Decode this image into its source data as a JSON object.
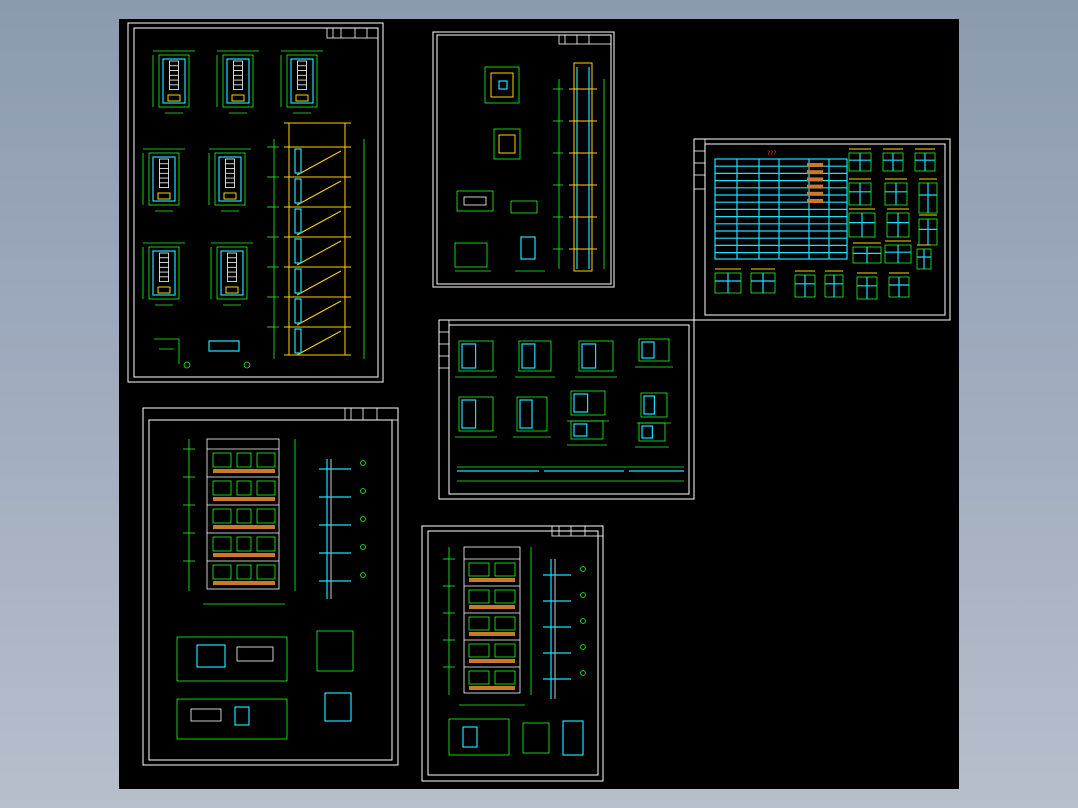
{
  "app": {
    "canvas_background": "#000000",
    "window_background": "#9aa6b8"
  },
  "colors": {
    "line_green": "#1cff1c",
    "line_cyan": "#19e0ff",
    "line_yellow": "#ffd400",
    "line_white": "#ffffff",
    "text_red": "#ff3b3b",
    "fill_orange": "#c87a2a"
  },
  "sheets": [
    {
      "name": "stair-plans-and-section-sheet"
    },
    {
      "name": "elevator-details-sheet"
    },
    {
      "name": "door-window-schedule-sheet"
    },
    {
      "name": "node-details-sheet"
    },
    {
      "name": "elevation-section-sheet-a"
    },
    {
      "name": "elevation-section-sheet-b"
    }
  ],
  "schedule": {
    "title": "???"
  }
}
